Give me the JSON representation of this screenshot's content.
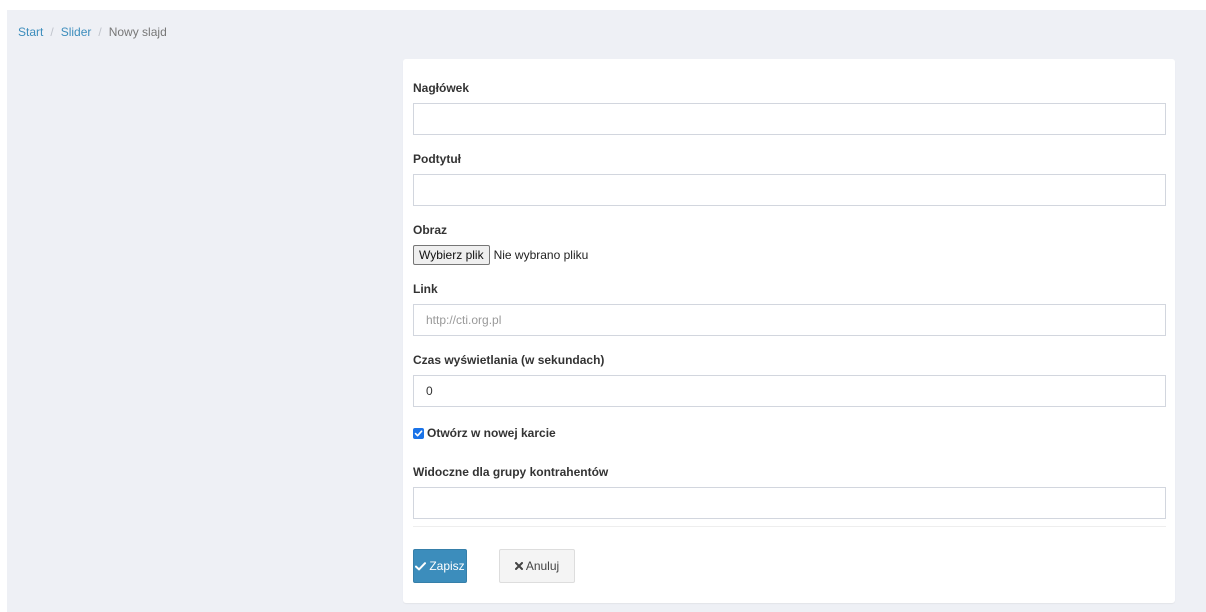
{
  "breadcrumb": {
    "items": [
      "Start",
      "Slider"
    ],
    "separator": "/",
    "current": "Nowy slajd"
  },
  "form": {
    "header": {
      "label": "Nagłówek",
      "value": ""
    },
    "subtitle": {
      "label": "Podtytuł",
      "value": ""
    },
    "image": {
      "label": "Obraz",
      "button_label": "Wybierz plik",
      "status": "Nie wybrano pliku"
    },
    "link": {
      "label": "Link",
      "value": "",
      "placeholder": "http://cti.org.pl"
    },
    "duration": {
      "label": "Czas wyświetlania (w sekundach)",
      "value": "0"
    },
    "new_tab": {
      "label": "Otwórz w nowej karcie",
      "checked": true
    },
    "groups": {
      "label": "Widoczne dla grupy kontrahentów",
      "value": ""
    }
  },
  "actions": {
    "save_label": "Zapisz",
    "cancel_label": "Anuluj"
  },
  "icons": {
    "save": "check-icon",
    "cancel": "times-icon",
    "checkbox": "checkmark-icon"
  },
  "colors": {
    "link": "#3c8dbc",
    "primary": "#3c8dbc",
    "background": "#eef0f5",
    "checkbox": "#1a73e8"
  }
}
